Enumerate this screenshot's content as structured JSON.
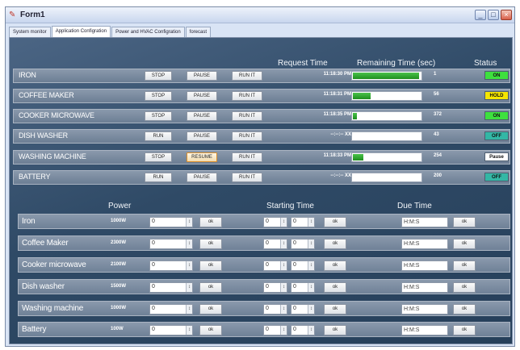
{
  "window": {
    "title": "Form1",
    "title_icon": "form-icon",
    "controls": {
      "minimize": "_",
      "maximize": "□",
      "close": "×"
    }
  },
  "tabs": [
    {
      "label": "System monitor",
      "active": false
    },
    {
      "label": "Application Configration",
      "active": true
    },
    {
      "label": "Power and HVAC Configration",
      "active": false
    },
    {
      "label": "forecast",
      "active": false
    }
  ],
  "table1": {
    "headers": {
      "request_time": "Request Time",
      "remaining_time": "Remaining Time (sec)",
      "status": "Status"
    },
    "button_labels": {
      "stop": "STOP",
      "run": "RUN",
      "pause": "PAUSE",
      "resume": "RESUME",
      "run_it": "RUN IT"
    },
    "rows": [
      {
        "name": "IRON",
        "btn1": "STOP",
        "btn2": "PAUSE",
        "btn3": "RUN IT",
        "request_time": "11:18:30 PM",
        "progress": 0.95,
        "remaining": "1",
        "status": "ON",
        "status_color": "#3ee03e"
      },
      {
        "name": "COFFEE MAKER",
        "btn1": "STOP",
        "btn2": "PAUSE",
        "btn3": "RUN IT",
        "request_time": "11:18:31 PM",
        "progress": 0.25,
        "remaining": "56",
        "status": "HOLD",
        "status_color": "#f5e600"
      },
      {
        "name": "COOKER MICROWAVE",
        "btn1": "STOP",
        "btn2": "PAUSE",
        "btn3": "RUN IT",
        "request_time": "11:18:35 PM",
        "progress": 0.06,
        "remaining": "372",
        "status": "ON",
        "status_color": "#3ee03e"
      },
      {
        "name": "DISH WASHER",
        "btn1": "RUN",
        "btn2": "PAUSE",
        "btn3": "RUN IT",
        "request_time": "--:--:-- XX",
        "progress": 0,
        "remaining": "43",
        "status": "OFF",
        "status_color": "#33b7a5"
      },
      {
        "name": "WASHING MACHINE",
        "btn1": "STOP",
        "btn2": "RESUME",
        "btn3": "RUN IT",
        "request_time": "11:18:33 PM",
        "progress": 0.15,
        "remaining": "254",
        "status": "Pause",
        "status_color": "#ffffff"
      },
      {
        "name": "BATTERY",
        "btn1": "RUN",
        "btn2": "PAUSE",
        "btn3": "RUN IT",
        "request_time": "--:--:-- XX",
        "progress": 0,
        "remaining": "200",
        "status": "OFF",
        "status_color": "#33b7a5"
      }
    ]
  },
  "table2": {
    "headers": {
      "power": "Power",
      "starting_time": "Starting Time",
      "due_time": "Due Time"
    },
    "ok_label": "ok",
    "rows": [
      {
        "name": "Iron",
        "watt": "1000W",
        "power_value": "0",
        "start_h": "0",
        "start_m": "0",
        "due": "H:M:S"
      },
      {
        "name": "Coffee Maker",
        "watt": "2300W",
        "power_value": "0",
        "start_h": "0",
        "start_m": "0",
        "due": "H:M:S"
      },
      {
        "name": "Cooker microwave",
        "watt": "2100W",
        "power_value": "0",
        "start_h": "0",
        "start_m": "0",
        "due": "H:M:S"
      },
      {
        "name": "Dish washer",
        "watt": "1500W",
        "power_value": "0",
        "start_h": "0",
        "start_m": "0",
        "due": "H:M:S"
      },
      {
        "name": "Washing machine",
        "watt": "1000W",
        "power_value": "0",
        "start_h": "0",
        "start_m": "0",
        "due": "H:M:S"
      },
      {
        "name": "Battery",
        "watt": "100W",
        "power_value": "0",
        "start_h": "0",
        "start_m": "0",
        "due": "H:M:S"
      }
    ]
  }
}
